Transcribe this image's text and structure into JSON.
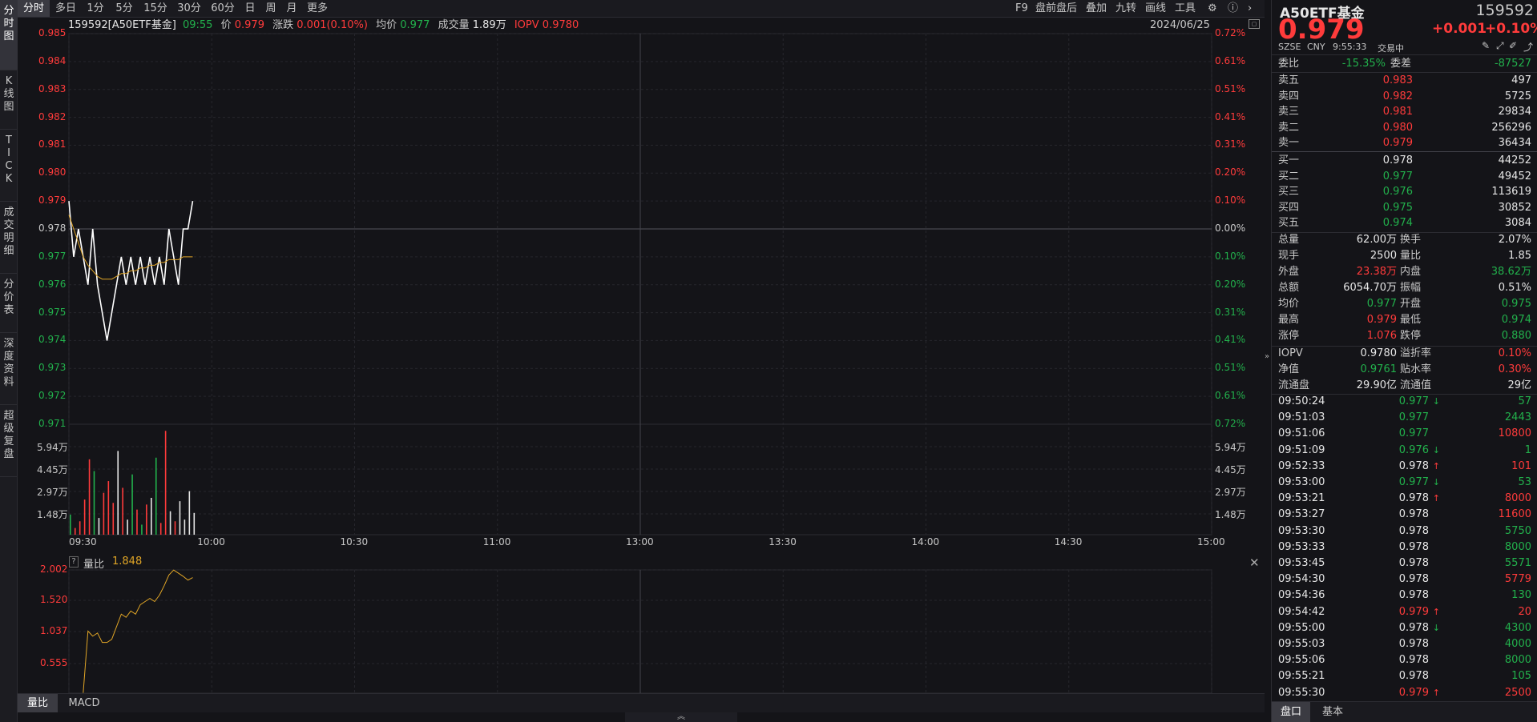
{
  "left_tabs": [
    "分时图",
    "K线图",
    "TICK",
    "成交明细",
    "分价表",
    "深度资料",
    "超级复盘"
  ],
  "period_tabs": [
    "分时",
    "多日",
    "1分",
    "5分",
    "15分",
    "30分",
    "60分",
    "日",
    "周",
    "月",
    "更多"
  ],
  "toolbar": {
    "f9": "F9",
    "pre_after": "盘前盘后",
    "overlay": "叠加",
    "nine": "九转",
    "draw": "画线",
    "tools": "工具",
    "settings_icon": "gear-icon",
    "help_icon": "help-icon",
    "next_icon": "chevron-right-icon"
  },
  "info": {
    "code_name": "159592[A50ETF基金]",
    "time": "09:55",
    "price_label": "价",
    "price": "0.979",
    "chg_label": "涨跌",
    "chg": "0.001(0.10%)",
    "avg_label": "均价",
    "avg": "0.977",
    "vol_label": "成交量",
    "vol": "1.89万",
    "iopv_label": "IOPV",
    "iopv": "0.9780",
    "date": "2024/06/25"
  },
  "price_axis": [
    "0.985",
    "0.984",
    "0.983",
    "0.982",
    "0.981",
    "0.980",
    "0.979",
    "0.978",
    "0.977",
    "0.976",
    "0.975",
    "0.974",
    "0.973",
    "0.972",
    "0.971"
  ],
  "pct_axis": [
    "0.72%",
    "0.61%",
    "0.51%",
    "0.41%",
    "0.31%",
    "0.20%",
    "0.10%",
    "0.00%",
    "0.10%",
    "0.20%",
    "0.31%",
    "0.41%",
    "0.51%",
    "0.61%",
    "0.72%"
  ],
  "vol_axis": [
    "5.94万",
    "4.45万",
    "2.97万",
    "1.48万"
  ],
  "time_axis": [
    "09:30",
    "10:00",
    "10:30",
    "11:00",
    "13:00",
    "13:30",
    "14:00",
    "14:30",
    "15:00"
  ],
  "colors": {
    "up": "#ff3b3b",
    "down": "#22b14c",
    "price_line": "#ffffff",
    "avg_line": "#e0a526",
    "volratio_line": "#e0a526"
  },
  "chart_data": [
    {
      "type": "line",
      "title": "",
      "series": [
        {
          "name": "价",
          "values": [
            0.979,
            0.977,
            0.978,
            0.977,
            0.976,
            0.978,
            0.976,
            0.975,
            0.974,
            0.975,
            0.976,
            0.977,
            0.976,
            0.977,
            0.976,
            0.977,
            0.976,
            0.977,
            0.976,
            0.977,
            0.976,
            0.978,
            0.977,
            0.976,
            0.978,
            0.978,
            0.979
          ]
        },
        {
          "name": "均价",
          "values": [
            0.9785,
            0.978,
            0.9775,
            0.977,
            0.9767,
            0.9765,
            0.9763,
            0.9762,
            0.9762,
            0.9762,
            0.9763,
            0.9764,
            0.9764,
            0.9765,
            0.9765,
            0.9766,
            0.9766,
            0.9767,
            0.9767,
            0.9768,
            0.9768,
            0.9769,
            0.9769,
            0.9769,
            0.977,
            0.977,
            0.977
          ]
        }
      ],
      "ylim": [
        0.971,
        0.985
      ],
      "x_range": [
        "09:30",
        "15:00"
      ],
      "prev_close": 0.978
    },
    {
      "type": "bar",
      "title": "",
      "values": [
        1.2,
        0.4,
        0.8,
        2.1,
        4.5,
        3.8,
        1.0,
        2.5,
        3.2,
        1.9,
        5.0,
        2.8,
        0.9,
        3.6,
        1.5,
        0.6,
        1.8,
        2.2,
        4.6,
        0.7,
        6.2,
        1.4,
        0.8,
        2.0,
        0.9,
        2.6,
        1.3
      ],
      "colors": [
        "g",
        "r",
        "r",
        "r",
        "r",
        "g",
        "w",
        "r",
        "r",
        "r",
        "w",
        "r",
        "w",
        "g",
        "r",
        "g",
        "r",
        "w",
        "g",
        "r",
        "r",
        "w",
        "r",
        "w",
        "w",
        "w",
        "w"
      ],
      "ylim": [
        0,
        6.5
      ],
      "unit": "万"
    },
    {
      "type": "line",
      "title": "量比",
      "value": "1.848",
      "series": [
        {
          "name": "量比",
          "values": [
            0.05,
            1.03,
            0.95,
            1.0,
            0.85,
            0.85,
            0.9,
            1.1,
            1.3,
            1.25,
            1.35,
            1.3,
            1.45,
            1.5,
            1.55,
            1.5,
            1.6,
            1.75,
            1.92,
            2.0,
            1.95,
            1.9,
            1.84,
            1.88
          ]
        }
      ],
      "yticks": [
        "2.002",
        "1.520",
        "1.037",
        "0.555"
      ],
      "ylim": [
        0.07,
        2.002
      ]
    }
  ],
  "sub_title": "量比",
  "sub_value": "1.848",
  "bottom_tabs": [
    "量比",
    "MACD"
  ],
  "quote": {
    "name": "A50ETF基金",
    "code": "159592",
    "price": "0.979",
    "chg": "+0.001",
    "pct": "+0.10%",
    "exchange": "SZSE",
    "currency": "CNY",
    "qtime": "9:55:33",
    "status": "交易中",
    "weibi_label": "委比",
    "weibi": "-15.35%",
    "weicha_label": "委差",
    "weicha": "-87527"
  },
  "asks": [
    {
      "label": "卖五",
      "price": "0.983",
      "vol": "497"
    },
    {
      "label": "卖四",
      "price": "0.982",
      "vol": "5725"
    },
    {
      "label": "卖三",
      "price": "0.981",
      "vol": "29834"
    },
    {
      "label": "卖二",
      "price": "0.980",
      "vol": "256296"
    },
    {
      "label": "卖一",
      "price": "0.979",
      "vol": "36434"
    }
  ],
  "bids": [
    {
      "label": "买一",
      "price": "0.978",
      "vol": "44252"
    },
    {
      "label": "买二",
      "price": "0.977",
      "vol": "49452"
    },
    {
      "label": "买三",
      "price": "0.976",
      "vol": "113619"
    },
    {
      "label": "买四",
      "price": "0.975",
      "vol": "30852"
    },
    {
      "label": "买五",
      "price": "0.974",
      "vol": "3084"
    }
  ],
  "stats": [
    {
      "l1": "总量",
      "v1": "62.00万",
      "c1": "w",
      "l2": "换手",
      "v2": "2.07%",
      "c2": "w"
    },
    {
      "l1": "现手",
      "v1": "2500",
      "c1": "w",
      "l2": "量比",
      "v2": "1.85",
      "c2": "w"
    },
    {
      "l1": "外盘",
      "v1": "23.38万",
      "c1": "r",
      "l2": "内盘",
      "v2": "38.62万",
      "c2": "g"
    },
    {
      "l1": "总额",
      "v1": "6054.70万",
      "c1": "w",
      "l2": "振幅",
      "v2": "0.51%",
      "c2": "w"
    },
    {
      "l1": "均价",
      "v1": "0.977",
      "c1": "g",
      "l2": "开盘",
      "v2": "0.975",
      "c2": "g"
    },
    {
      "l1": "最高",
      "v1": "0.979",
      "c1": "r",
      "l2": "最低",
      "v2": "0.974",
      "c2": "g"
    },
    {
      "l1": "涨停",
      "v1": "1.076",
      "c1": "r",
      "l2": "跌停",
      "v2": "0.880",
      "c2": "g"
    }
  ],
  "stats2": [
    {
      "l1": "IOPV",
      "v1": "0.9780",
      "c1": "w",
      "l2": "溢折率",
      "v2": "0.10%",
      "c2": "r"
    },
    {
      "l1": "净值",
      "v1": "0.9761",
      "c1": "g",
      "l2": "贴水率",
      "v2": "0.30%",
      "c2": "r"
    },
    {
      "l1": "流通盘",
      "v1": "29.90亿",
      "c1": "w",
      "l2": "流通值",
      "v2": "29亿",
      "c2": "w"
    }
  ],
  "ticks": [
    {
      "t": "09:50:24",
      "p": "0.977",
      "pc": "g",
      "a": "down",
      "v": "57",
      "vc": "g"
    },
    {
      "t": "09:51:03",
      "p": "0.977",
      "pc": "g",
      "a": "",
      "v": "2443",
      "vc": "g"
    },
    {
      "t": "09:51:06",
      "p": "0.977",
      "pc": "g",
      "a": "",
      "v": "10800",
      "vc": "r"
    },
    {
      "t": "09:51:09",
      "p": "0.976",
      "pc": "g",
      "a": "down",
      "v": "1",
      "vc": "g"
    },
    {
      "t": "09:52:33",
      "p": "0.978",
      "pc": "w",
      "a": "up",
      "v": "101",
      "vc": "r"
    },
    {
      "t": "09:53:00",
      "p": "0.977",
      "pc": "g",
      "a": "down",
      "v": "53",
      "vc": "g"
    },
    {
      "t": "09:53:21",
      "p": "0.978",
      "pc": "w",
      "a": "up",
      "v": "8000",
      "vc": "r"
    },
    {
      "t": "09:53:27",
      "p": "0.978",
      "pc": "w",
      "a": "",
      "v": "11600",
      "vc": "r"
    },
    {
      "t": "09:53:30",
      "p": "0.978",
      "pc": "w",
      "a": "",
      "v": "5750",
      "vc": "g"
    },
    {
      "t": "09:53:33",
      "p": "0.978",
      "pc": "w",
      "a": "",
      "v": "8000",
      "vc": "g"
    },
    {
      "t": "09:53:45",
      "p": "0.978",
      "pc": "w",
      "a": "",
      "v": "5571",
      "vc": "g"
    },
    {
      "t": "09:54:30",
      "p": "0.978",
      "pc": "w",
      "a": "",
      "v": "5779",
      "vc": "r"
    },
    {
      "t": "09:54:36",
      "p": "0.978",
      "pc": "w",
      "a": "",
      "v": "130",
      "vc": "g"
    },
    {
      "t": "09:54:42",
      "p": "0.979",
      "pc": "r",
      "a": "up",
      "v": "20",
      "vc": "r"
    },
    {
      "t": "09:55:00",
      "p": "0.978",
      "pc": "w",
      "a": "down",
      "v": "4300",
      "vc": "g"
    },
    {
      "t": "09:55:03",
      "p": "0.978",
      "pc": "w",
      "a": "",
      "v": "4000",
      "vc": "g"
    },
    {
      "t": "09:55:06",
      "p": "0.978",
      "pc": "w",
      "a": "",
      "v": "8000",
      "vc": "g"
    },
    {
      "t": "09:55:21",
      "p": "0.978",
      "pc": "w",
      "a": "",
      "v": "105",
      "vc": "g"
    },
    {
      "t": "09:55:30",
      "p": "0.979",
      "pc": "r",
      "a": "up",
      "v": "2500",
      "vc": "r"
    }
  ],
  "right_tabs": [
    "盘口",
    "基本"
  ]
}
